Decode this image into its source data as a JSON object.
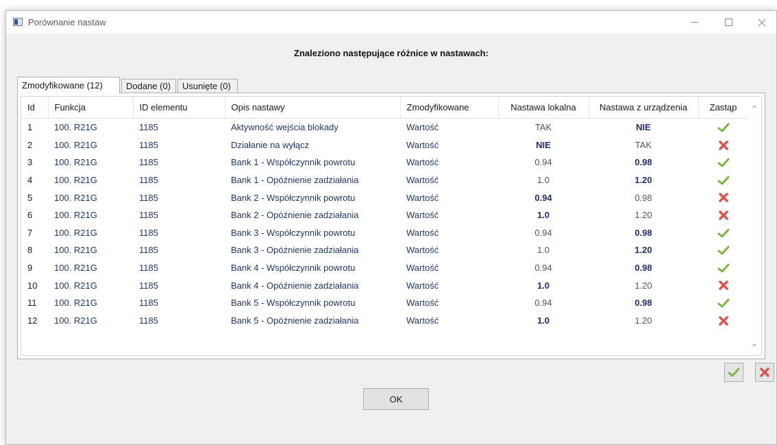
{
  "window": {
    "title": "Porównanie nastaw",
    "icon": "app-icon"
  },
  "heading": "Znaleziono następujące różnice w nastawach:",
  "tabs": [
    {
      "label": "Zmodyfikowane (12)",
      "active": true
    },
    {
      "label": "Dodane (0)",
      "active": false
    },
    {
      "label": "Usunięte (0)",
      "active": false
    }
  ],
  "table": {
    "columns": [
      "Id",
      "Funkcja",
      "ID elementu",
      "Opis nastawy",
      "Zmodyfikowane",
      "Nastawa lokalna",
      "Nastawa z urządzenia",
      "Zastąp"
    ],
    "rows": [
      {
        "id": "1",
        "funkcja": "100. R21G",
        "element": "1185",
        "opis": "Aktywność wejścia blokady",
        "zmod": "Wartość",
        "lokalna": "TAK",
        "urzadzenie": "NIE",
        "zastap": "check"
      },
      {
        "id": "2",
        "funkcja": "100. R21G",
        "element": "1185",
        "opis": "Działanie na wyłącz",
        "zmod": "Wartość",
        "lokalna": "NIE",
        "urzadzenie": "TAK",
        "zastap": "cross"
      },
      {
        "id": "3",
        "funkcja": "100. R21G",
        "element": "1185",
        "opis": "Bank 1 - Współczynnik powrotu",
        "zmod": "Wartość",
        "lokalna": "0.94",
        "urzadzenie": "0.98",
        "zastap": "check"
      },
      {
        "id": "4",
        "funkcja": "100. R21G",
        "element": "1185",
        "opis": "Bank 1 - Opóźnienie zadziałania",
        "zmod": "Wartość",
        "lokalna": "1.0",
        "urzadzenie": "1.20",
        "zastap": "check"
      },
      {
        "id": "5",
        "funkcja": "100. R21G",
        "element": "1185",
        "opis": "Bank 2 - Współczynnik powrotu",
        "zmod": "Wartość",
        "lokalna": "0.94",
        "urzadzenie": "0.98",
        "zastap": "cross"
      },
      {
        "id": "6",
        "funkcja": "100. R21G",
        "element": "1185",
        "opis": "Bank 2 - Opóźnienie zadziałania",
        "zmod": "Wartość",
        "lokalna": "1.0",
        "urzadzenie": "1.20",
        "zastap": "cross"
      },
      {
        "id": "7",
        "funkcja": "100. R21G",
        "element": "1185",
        "opis": "Bank 3 - Współczynnik powrotu",
        "zmod": "Wartość",
        "lokalna": "0.94",
        "urzadzenie": "0.98",
        "zastap": "check"
      },
      {
        "id": "8",
        "funkcja": "100. R21G",
        "element": "1185",
        "opis": "Bank 3 - Opóźnienie zadziałania",
        "zmod": "Wartość",
        "lokalna": "1.0",
        "urzadzenie": "1.20",
        "zastap": "check"
      },
      {
        "id": "9",
        "funkcja": "100. R21G",
        "element": "1185",
        "opis": "Bank 4 - Współczynnik powrotu",
        "zmod": "Wartość",
        "lokalna": "0.94",
        "urzadzenie": "0.98",
        "zastap": "check"
      },
      {
        "id": "10",
        "funkcja": "100. R21G",
        "element": "1185",
        "opis": "Bank 4 - Opóźnienie zadziałania",
        "zmod": "Wartość",
        "lokalna": "1.0",
        "urzadzenie": "1.20",
        "zastap": "cross"
      },
      {
        "id": "11",
        "funkcja": "100. R21G",
        "element": "1185",
        "opis": "Bank 5 - Współczynnik powrotu",
        "zmod": "Wartość",
        "lokalna": "0.94",
        "urzadzenie": "0.98",
        "zastap": "check"
      },
      {
        "id": "12",
        "funkcja": "100. R21G",
        "element": "1185",
        "opis": "Bank 5 - Opóźnienie zadziałania",
        "zmod": "Wartość",
        "lokalna": "1.0",
        "urzadzenie": "1.20",
        "zastap": "cross"
      }
    ]
  },
  "actions": {
    "accept_all_icon": "check-icon",
    "reject_all_icon": "cross-icon"
  },
  "ok_label": "OK",
  "colors": {
    "check": "#7cb342",
    "cross": "#d9534f",
    "bold_value": "#1f2f6b"
  }
}
